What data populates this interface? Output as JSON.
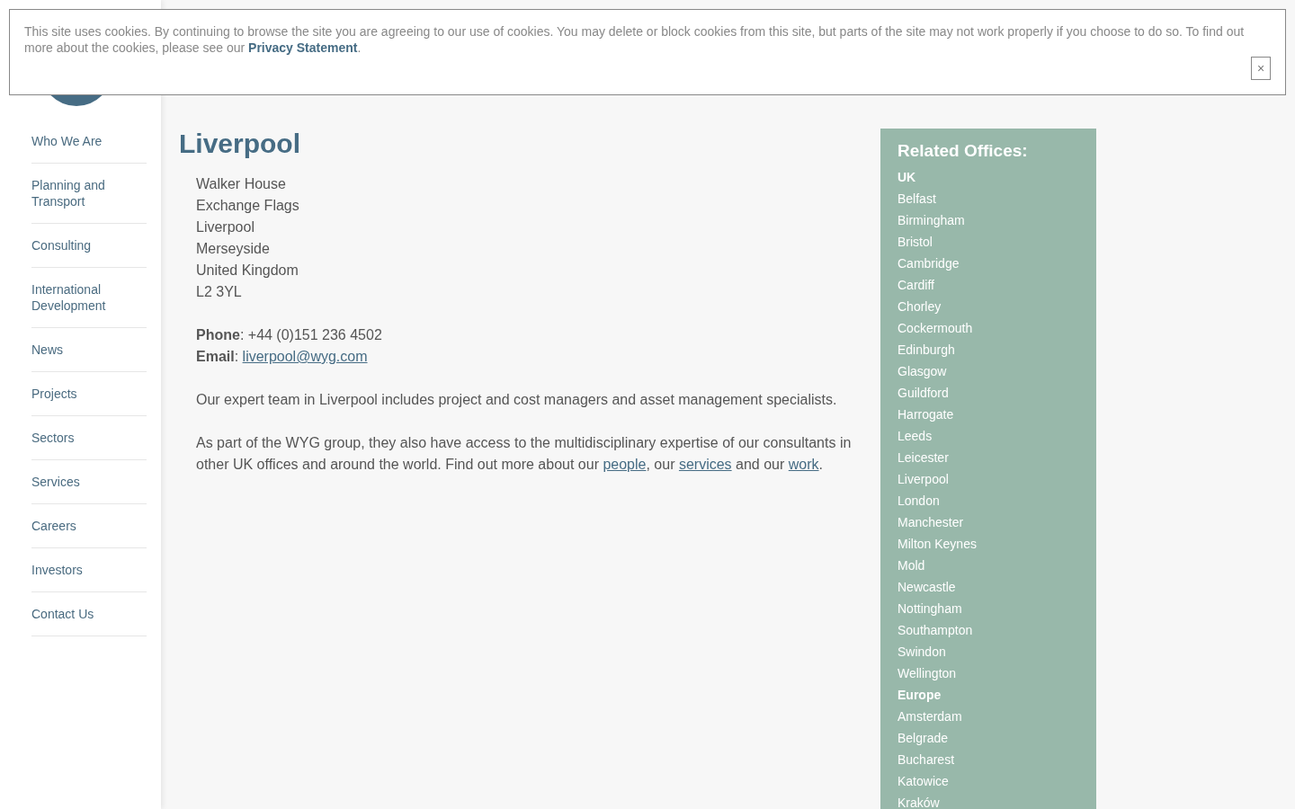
{
  "cookie_banner": {
    "text_before": "This site uses cookies. By continuing to browse the site you are agreeing to our use of cookies. You may delete or block cookies from this site, but parts of the site may not work properly if you choose to do so. To find out more about the cookies, please see our ",
    "link": "Privacy Statement",
    "text_after": ".",
    "close": "×"
  },
  "sidebar": {
    "items": [
      {
        "label": "Who We Are"
      },
      {
        "label": "Planning and Transport"
      },
      {
        "label": "Consulting"
      },
      {
        "label": "International Development"
      },
      {
        "label": "News"
      },
      {
        "label": "Projects"
      },
      {
        "label": "Sectors"
      },
      {
        "label": "Services"
      },
      {
        "label": "Careers"
      },
      {
        "label": "Investors"
      },
      {
        "label": "Contact Us"
      }
    ]
  },
  "title": "Liverpool",
  "address": [
    "Walker House",
    "Exchange Flags",
    "Liverpool",
    "Merseyside",
    "United Kingdom",
    "L2 3YL"
  ],
  "phone": "**Phone**: +44 (0)151 236 4502",
  "email": {
    "label": "**Email**: ",
    "link": "liverpool@wyg.com"
  },
  "paragraphs": [
    [
      {
        "kind": "text",
        "text": "Our expert team in Liverpool includes project and cost managers and asset management specialists."
      }
    ],
    [
      {
        "kind": "text",
        "text": "As part of the WYG group, they also have access to the multidisciplinary expertise of our consultants in other UK offices and around the world. Find out more about our "
      },
      {
        "kind": "link",
        "text": "people"
      },
      {
        "kind": "text",
        "text": ", our "
      },
      {
        "kind": "link",
        "text": "services"
      },
      {
        "kind": "text",
        "text": " and our "
      },
      {
        "kind": "link",
        "text": "work"
      },
      {
        "kind": "text",
        "text": "."
      }
    ]
  ],
  "related": {
    "title": "Related Offices:",
    "items": [
      {
        "kind": "heading",
        "label": "UK"
      },
      {
        "kind": "office",
        "label": "Belfast"
      },
      {
        "kind": "office",
        "label": "Birmingham"
      },
      {
        "kind": "office",
        "label": "Bristol"
      },
      {
        "kind": "office",
        "label": "Cambridge"
      },
      {
        "kind": "office",
        "label": "Cardiff"
      },
      {
        "kind": "office",
        "label": "Chorley"
      },
      {
        "kind": "office",
        "label": "Cockermouth"
      },
      {
        "kind": "office",
        "label": "Edinburgh"
      },
      {
        "kind": "office",
        "label": "Glasgow"
      },
      {
        "kind": "office",
        "label": "Guildford"
      },
      {
        "kind": "office",
        "label": "Harrogate"
      },
      {
        "kind": "office",
        "label": "Leeds"
      },
      {
        "kind": "office",
        "label": "Leicester"
      },
      {
        "kind": "office",
        "label": "Liverpool"
      },
      {
        "kind": "office",
        "label": "London"
      },
      {
        "kind": "office",
        "label": "Manchester"
      },
      {
        "kind": "office",
        "label": "Milton Keynes"
      },
      {
        "kind": "office",
        "label": "Mold"
      },
      {
        "kind": "office",
        "label": "Newcastle"
      },
      {
        "kind": "office",
        "label": "Nottingham"
      },
      {
        "kind": "office",
        "label": "Southampton"
      },
      {
        "kind": "office",
        "label": "Swindon"
      },
      {
        "kind": "office",
        "label": "Wellington"
      },
      {
        "kind": "heading",
        "label": "Europe"
      },
      {
        "kind": "office",
        "label": "Amsterdam"
      },
      {
        "kind": "office",
        "label": "Belgrade"
      },
      {
        "kind": "office",
        "label": "Bucharest"
      },
      {
        "kind": "office",
        "label": "Katowice"
      },
      {
        "kind": "office",
        "label": "Kraków"
      }
    ]
  }
}
